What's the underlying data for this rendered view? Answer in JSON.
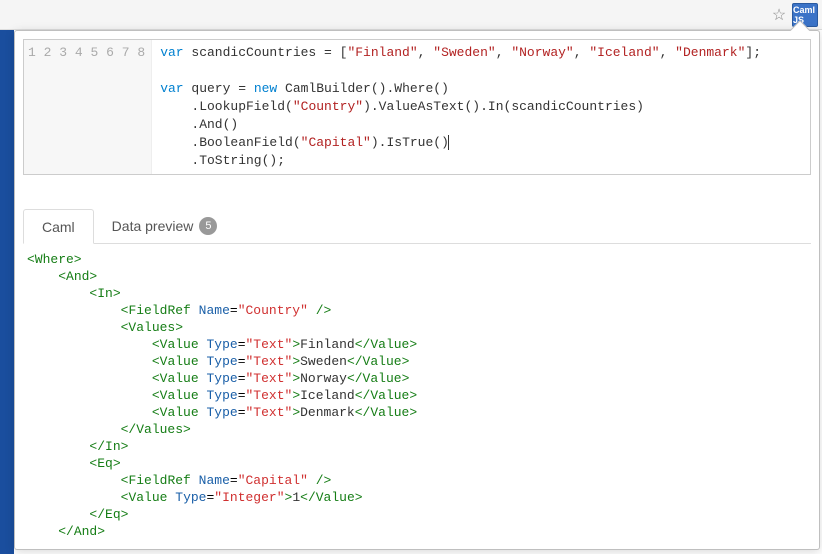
{
  "ext_label": "Caml\nJS",
  "editor": {
    "line_numbers": [
      "1",
      "2",
      "3",
      "4",
      "5",
      "6",
      "7",
      "8"
    ],
    "kw_var": "var",
    "kw_new": "new",
    "ident_scandic": "scandicCountries",
    "ident_query": "query",
    "str_finland": "\"Finland\"",
    "str_sweden": "\"Sweden\"",
    "str_norway": "\"Norway\"",
    "str_iceland": "\"Iceland\"",
    "str_denmark": "\"Denmark\"",
    "str_country": "\"Country\"",
    "str_capital": "\"Capital\"",
    "camlbuilder": "CamlBuilder",
    "where": "Where",
    "lookupfield": "LookupField",
    "valueastext": "ValueAsText",
    "in": "In",
    "and": "And",
    "booleanfield": "BooleanField",
    "istrue": "IsTrue",
    "tostring": "ToString"
  },
  "tabs": {
    "caml": "Caml",
    "data_preview": "Data preview",
    "badge": "5"
  },
  "caml": {
    "where_open": "<Where>",
    "where_close": "</Where>",
    "and_open": "<And>",
    "and_close": "</And>",
    "in_open": "<In>",
    "in_close": "</In>",
    "eq_open": "<Eq>",
    "eq_close": "</Eq>",
    "values_open": "<Values>",
    "values_close": "</Values>",
    "fieldref": "FieldRef",
    "name_attr": "Name",
    "type_attr": "Type",
    "value_tag": "Value",
    "country": "\"Country\"",
    "capital": "\"Capital\"",
    "text": "\"Text\"",
    "integer": "\"Integer\"",
    "finland": "Finland",
    "sweden": "Sweden",
    "norway": "Norway",
    "iceland": "Iceland",
    "denmark": "Denmark",
    "one": "1"
  }
}
